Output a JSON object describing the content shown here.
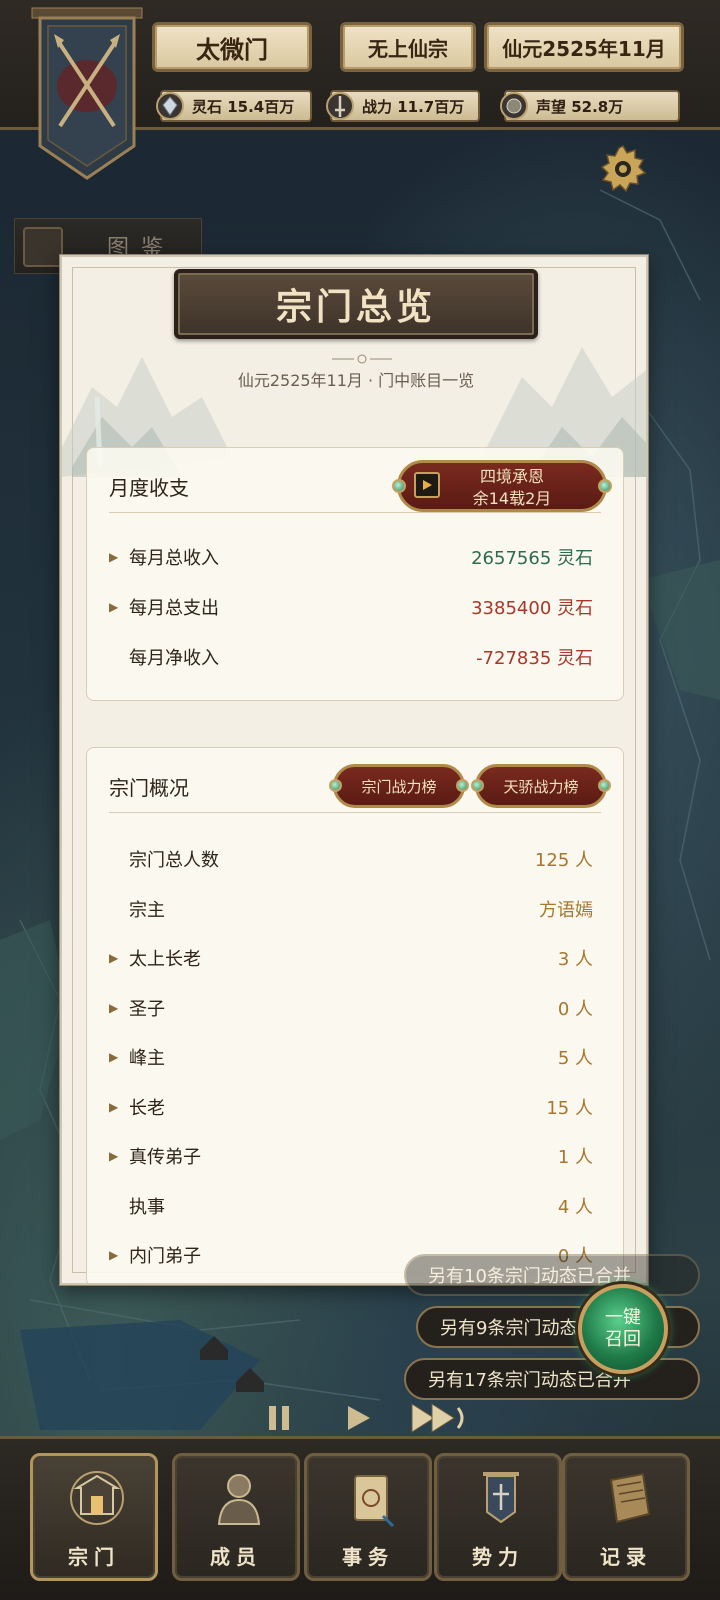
{
  "header": {
    "sect_name": "太微门",
    "sect_rank": "无上仙宗",
    "date": "仙元2525年11月",
    "resources": [
      {
        "icon": "spirit-stone-icon",
        "text": "灵石 15.4百万"
      },
      {
        "icon": "sword-icon",
        "text": "战力 11.7百万"
      },
      {
        "icon": "reputation-icon",
        "text": "声望 52.8万"
      }
    ]
  },
  "side_tab": {
    "label": "图鉴"
  },
  "panel": {
    "title": "宗门总览",
    "subtitle": "仙元2525年11月 · 门中账目一览",
    "monthly": {
      "title": "月度收支",
      "badge_line1": "四境承恩",
      "badge_line2": "余14载2月",
      "rows": [
        {
          "label": "每月总收入",
          "value": "2657565 灵石",
          "expandable": true
        },
        {
          "label": "每月总支出",
          "value": "3385400 灵石",
          "expandable": true
        },
        {
          "label": "每月净收入",
          "value": "-727835 灵石",
          "expandable": false
        }
      ]
    },
    "overview": {
      "title": "宗门概况",
      "btn_sect_power": "宗门战力榜",
      "btn_prodigy_power": "天骄战力榜",
      "rows": [
        {
          "label": "宗门总人数",
          "value": "125 人",
          "expandable": false
        },
        {
          "label": "宗主",
          "value": "方语嫣",
          "expandable": false
        },
        {
          "label": "太上长老",
          "value": "3 人",
          "expandable": true
        },
        {
          "label": "圣子",
          "value": "0 人",
          "expandable": true
        },
        {
          "label": "峰主",
          "value": "5 人",
          "expandable": true
        },
        {
          "label": "长老",
          "value": "15 人",
          "expandable": true
        },
        {
          "label": "真传弟子",
          "value": "1 人",
          "expandable": true
        },
        {
          "label": "执事",
          "value": "4 人",
          "expandable": false
        },
        {
          "label": "内门弟子",
          "value": "0 人",
          "expandable": true
        }
      ]
    }
  },
  "notices": [
    "另有10条宗门动态已合并",
    "另有9条宗门动态已合并",
    "另有17条宗门动态已合并"
  ],
  "recall_button": {
    "line1": "一键",
    "line2": "召回"
  },
  "bottom_nav": [
    {
      "label": "宗门",
      "icon": "sect-gate-icon"
    },
    {
      "label": "成员",
      "icon": "member-icon"
    },
    {
      "label": "事务",
      "icon": "scroll-icon"
    },
    {
      "label": "势力",
      "icon": "banner-flag-icon"
    },
    {
      "label": "记录",
      "icon": "book-icon"
    }
  ],
  "colors": {
    "income": "#2f6a4e",
    "expense": "#a7372b",
    "count": "#a7762f"
  }
}
